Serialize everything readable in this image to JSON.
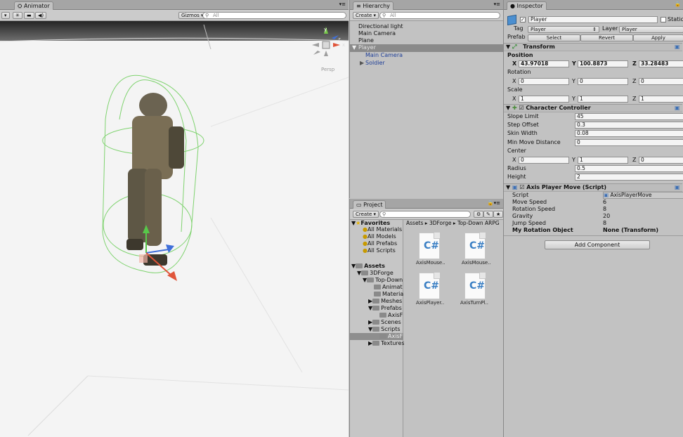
{
  "scene": {
    "tab_label": "Animator",
    "gizmos_label": "Gizmos",
    "search_placeholder": "All",
    "persp_label": "Persp",
    "axis_y": "y",
    "axis_x": "x",
    "axis_z": "z"
  },
  "hierarchy": {
    "tab_label": "Hierarchy",
    "create_label": "Create",
    "search_placeholder": "All",
    "items": [
      "Directional light",
      "Main Camera",
      "Plane",
      "Player",
      "Main Camera",
      "Soldier"
    ]
  },
  "project": {
    "tab_label": "Project",
    "create_label": "Create",
    "favorites_label": "Favorites",
    "favorites": [
      "All Materials",
      "All Models",
      "All Prefabs",
      "All Scripts"
    ],
    "assets_label": "Assets",
    "tree": [
      "3DForge",
      "Top-Down",
      "Animat",
      "Materia",
      "Meshes",
      "Prefabs",
      "AxisF",
      "Scenes",
      "Scripts",
      "AxisF",
      "Textures"
    ],
    "breadcrumb": [
      "Assets",
      "3DForge",
      "Top-Down ARPG"
    ],
    "files": [
      "AxisMouse..",
      "AxisMouse..",
      "AxisPlayer..",
      "AxisTurnPl.."
    ]
  },
  "inspector": {
    "tab_label": "Inspector",
    "object_name": "Player",
    "static_label": "Static",
    "tag_label": "Tag",
    "tag_value": "Player",
    "layer_label": "Layer",
    "layer_value": "Player",
    "prefab_label": "Prefab",
    "prefab_buttons": [
      "Select",
      "Revert",
      "Apply"
    ],
    "transform": {
      "title": "Transform",
      "position_label": "Position",
      "position": {
        "x": "43.97018",
        "y": "100.8873",
        "z": "33.28483"
      },
      "rotation_label": "Rotation",
      "rotation": {
        "x": "0",
        "y": "0",
        "z": "0"
      },
      "scale_label": "Scale",
      "scale": {
        "x": "1",
        "y": "1",
        "z": "1"
      },
      "axis_labels": [
        "X",
        "Y",
        "Z"
      ]
    },
    "character_controller": {
      "title": "Character Controller",
      "fields": [
        {
          "label": "Slope Limit",
          "value": "45"
        },
        {
          "label": "Step Offset",
          "value": "0.3"
        },
        {
          "label": "Skin Width",
          "value": "0.08"
        },
        {
          "label": "Min Move Distance",
          "value": "0"
        }
      ],
      "center_label": "Center",
      "center": {
        "x": "0",
        "y": "1",
        "z": "0"
      },
      "radius_label": "Radius",
      "radius": "0.5",
      "height_label": "Height",
      "height": "2"
    },
    "script_component": {
      "title": "Axis Player Move (Script)",
      "script_label": "Script",
      "script_value": "AxisPlayerMove",
      "fields": [
        {
          "label": "Move Speed",
          "value": "6"
        },
        {
          "label": "Rotation Speed",
          "value": "8"
        },
        {
          "label": "Gravity",
          "value": "20"
        },
        {
          "label": "Jump Speed",
          "value": "8"
        },
        {
          "label": "My Rotation Object",
          "value": "None (Transform)"
        }
      ]
    },
    "add_component_label": "Add Component"
  }
}
